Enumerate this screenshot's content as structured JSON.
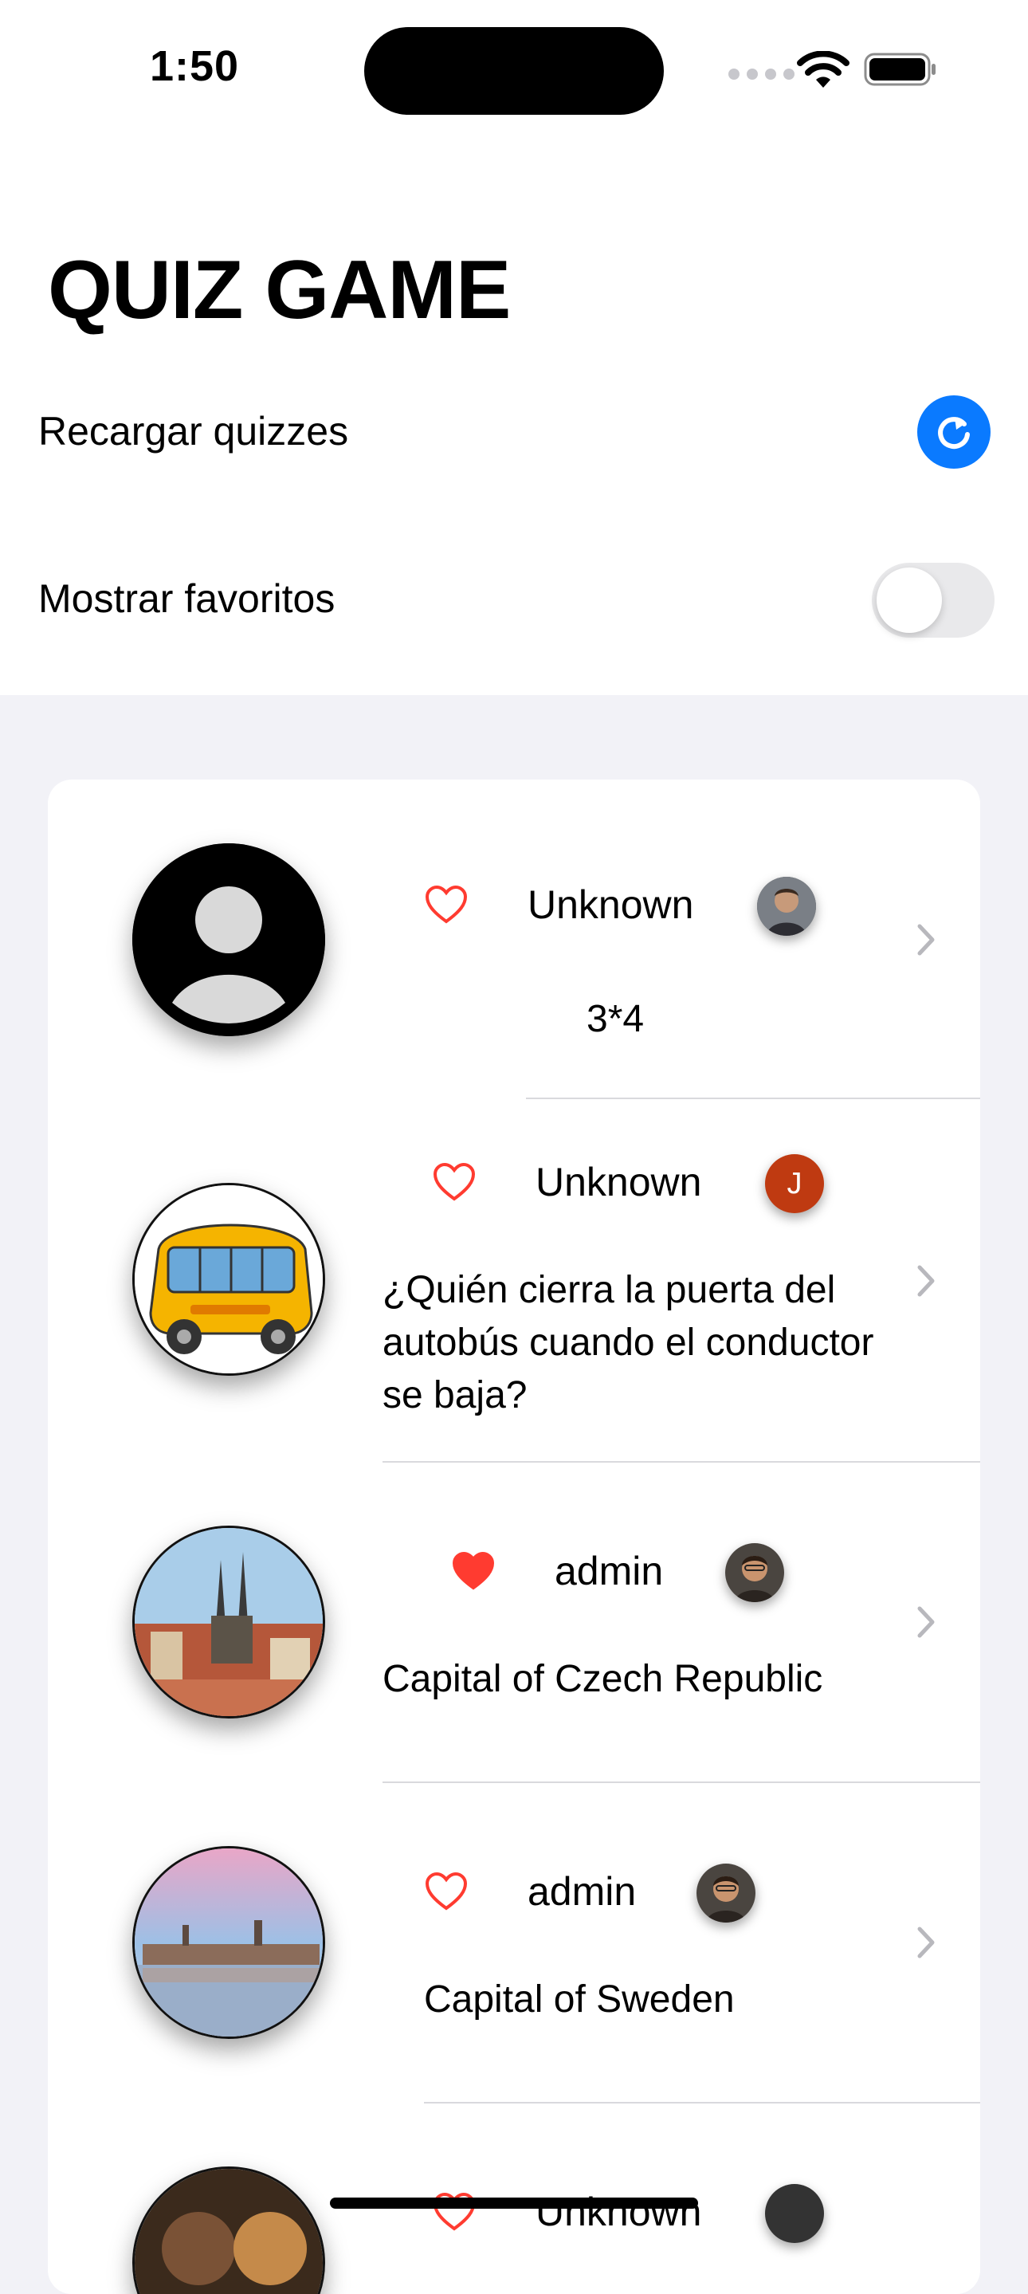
{
  "status_bar": {
    "time": "1:50"
  },
  "header": {
    "title": "QUIZ GAME",
    "reload_label": "Recargar quizzes",
    "favorites_label": "Mostrar favoritos",
    "favorites_on": false,
    "accent": "#0a7aff"
  },
  "quizzes": [
    {
      "author": "Unknown",
      "question": "3*4",
      "favourite": false
    },
    {
      "author": "Unknown",
      "author_initial": "J",
      "question": "¿Quién cierra la puerta del autobús cuando el conductor se baja?",
      "favourite": false
    },
    {
      "author": "admin",
      "question": "Capital of Czech Republic",
      "favourite": true
    },
    {
      "author": "admin",
      "question": "Capital of Sweden",
      "favourite": false
    },
    {
      "author": "Unknown",
      "question": "",
      "favourite": false
    }
  ],
  "colors": {
    "heart": "#ff3b30",
    "background": "#f2f2f7",
    "card": "#ffffff"
  }
}
